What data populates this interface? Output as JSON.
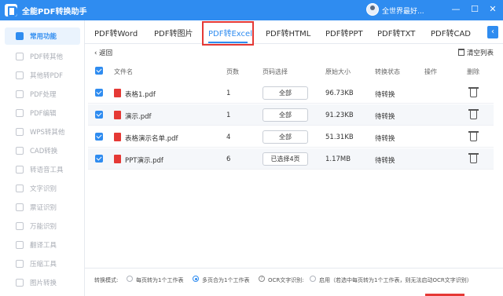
{
  "app": {
    "title": "全能PDF转换助手",
    "user": "全世界最好..."
  },
  "window_controls": {
    "minimize": "—",
    "maximize": "☐",
    "close": "✕"
  },
  "sidebar": {
    "items": [
      {
        "label": "常用功能",
        "icon": "home-icon",
        "active": true
      },
      {
        "label": "PDF转其他",
        "icon": "pdf-convert-icon"
      },
      {
        "label": "其他转PDF",
        "icon": "to-pdf-icon"
      },
      {
        "label": "PDF处理",
        "icon": "pdf-process-icon"
      },
      {
        "label": "PDF编辑",
        "icon": "pdf-edit-icon"
      },
      {
        "label": "WPS转其他",
        "icon": "wps-icon"
      },
      {
        "label": "CAD转换",
        "icon": "cad-icon"
      },
      {
        "label": "转语音工具",
        "icon": "voice-icon"
      },
      {
        "label": "文字识别",
        "icon": "ocr-icon"
      },
      {
        "label": "票证识别",
        "icon": "ticket-icon"
      },
      {
        "label": "万能识别",
        "icon": "scan-icon"
      },
      {
        "label": "翻译工具",
        "icon": "translate-icon"
      },
      {
        "label": "压缩工具",
        "icon": "compress-icon"
      },
      {
        "label": "图片转换",
        "icon": "image-icon"
      }
    ]
  },
  "tabs": [
    {
      "label": "PDF转Word"
    },
    {
      "label": "PDF转图片"
    },
    {
      "label": "PDF转Excel",
      "active": true
    },
    {
      "label": "PDF转HTML"
    },
    {
      "label": "PDF转PPT"
    },
    {
      "label": "PDF转TXT"
    },
    {
      "label": "PDF转CAD"
    }
  ],
  "tab_more": "‹",
  "toolbar": {
    "back": "‹ 返回",
    "clear_list": "清空列表"
  },
  "table": {
    "headers": [
      "文件名",
      "页数",
      "页码选择",
      "原始大小",
      "转换状态",
      "操作",
      "删除"
    ],
    "rows": [
      {
        "name": "表格1.pdf",
        "pages": "1",
        "page_select": "全部",
        "size": "96.73KB",
        "status": "待转换"
      },
      {
        "name": "演示.pdf",
        "pages": "1",
        "page_select": "全部",
        "size": "91.23KB",
        "status": "待转换"
      },
      {
        "name": "表格演示名单.pdf",
        "pages": "4",
        "page_select": "全部",
        "size": "51.31KB",
        "status": "待转换"
      },
      {
        "name": "PPT演示.pdf",
        "pages": "6",
        "page_select": "已选择4页",
        "size": "1.17MB",
        "status": "待转换"
      }
    ]
  },
  "bottom": {
    "mode_label": "转换模式:",
    "opt1": "每页转为1个工作表",
    "opt2": "多页合为1个工作表",
    "ocr_label": "OCR文字识别:",
    "ocr_opt": "启用（若选中每页转为1个工作表，则无法启动OCR文字识别）"
  },
  "colors": {
    "accent": "#2f8cf0",
    "highlight": "#e53935"
  }
}
